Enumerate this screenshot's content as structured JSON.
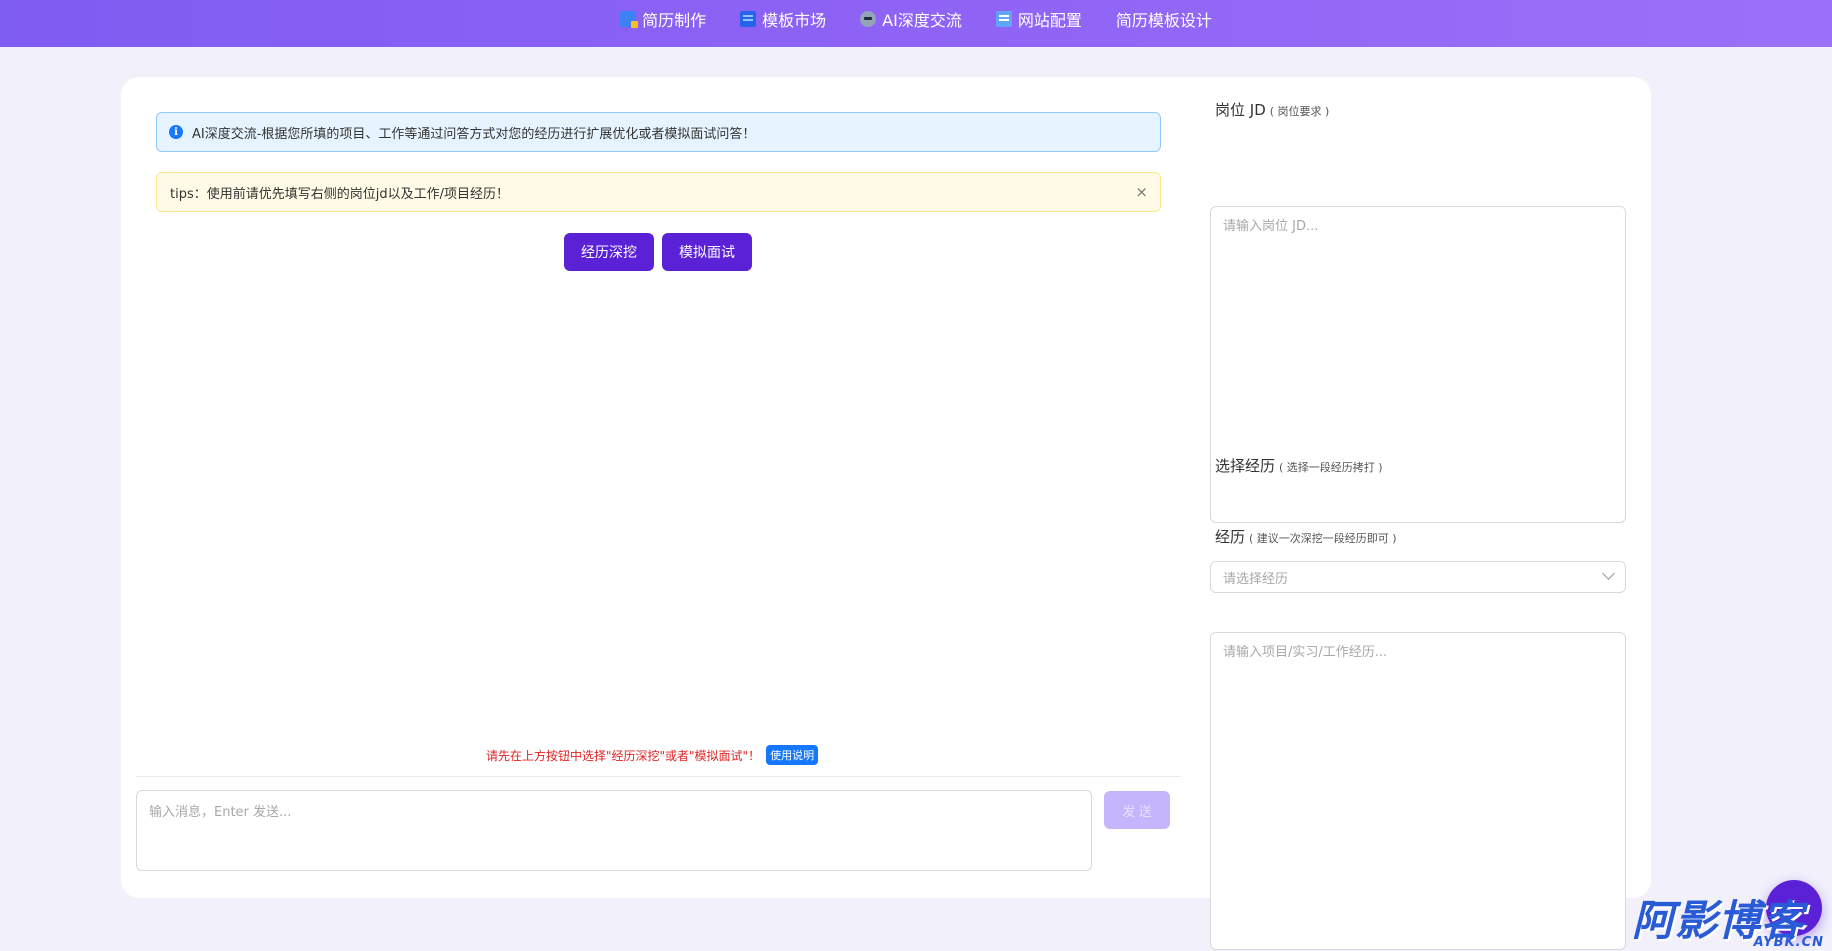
{
  "nav": {
    "items": [
      {
        "label": "简历制作",
        "icon": "resume-icon"
      },
      {
        "label": "模板市场",
        "icon": "template-icon"
      },
      {
        "label": "AI深度交流",
        "icon": "robot-icon"
      },
      {
        "label": "网站配置",
        "icon": "config-icon"
      },
      {
        "label": "简历模板设计",
        "icon": ""
      }
    ]
  },
  "chat": {
    "info_alert": "AI深度交流-根据您所填的项目、工作等通过问答方式对您的经历进行扩展优化或者模拟面试问答！",
    "tips_alert": "tips：使用前请优先填写右侧的岗位jd以及工作/项目经历！",
    "close_symbol": "×",
    "mode_buttons": [
      "经历深挖",
      "模拟面试"
    ],
    "hint_text": "请先在上方按钮中选择\"经历深挖\"或者\"模拟面试\"！",
    "help_badge": "使用说明",
    "input_placeholder": "输入消息，Enter 发送...",
    "send_label": "发 送"
  },
  "form": {
    "jd_label": "岗位 JD",
    "jd_sub": "( 岗位要求 )",
    "jd_placeholder": "请输入岗位 JD...",
    "select_label": "选择经历",
    "select_sub": "( 选择一段经历拷打 )",
    "select_placeholder": "请选择经历",
    "exp_label": "经历",
    "exp_sub": "( 建议一次深挖一段经历即可 )",
    "exp_placeholder": "请输入项目/实习/工作经历..."
  },
  "watermark": {
    "main": "阿影博客",
    "sub": "AYBK.CN"
  },
  "colors": {
    "nav_gradient_start": "#7f5cf2",
    "nav_gradient_end": "#9c70f8",
    "primary_button": "#5b21d6",
    "send_disabled": "#c4b5fd",
    "hint_red": "#e02424",
    "info_blue": "#1677ff"
  }
}
